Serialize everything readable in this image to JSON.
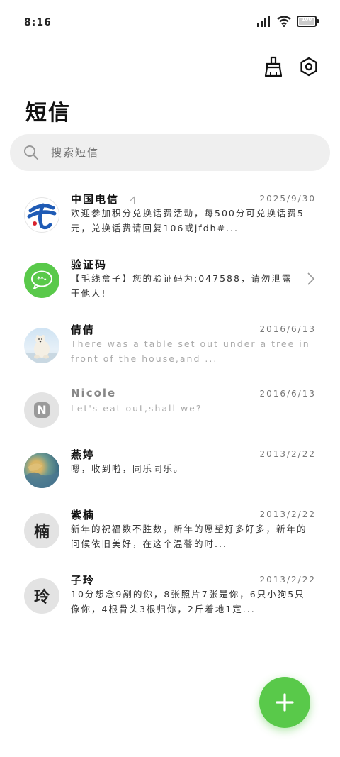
{
  "status_bar": {
    "time": "8:16",
    "battery_level": "100"
  },
  "header": {
    "title": "短信"
  },
  "search": {
    "placeholder": "搜索短信"
  },
  "threads": [
    {
      "name": "中国电信",
      "date": "2025/9/30",
      "preview": "欢迎参加积分兑换话费活动，每500分可兑换话费5元，兑换话费请回复106或jfdh#...",
      "avatar": "china-telecom-logo"
    },
    {
      "name": "验证码",
      "date": "",
      "preview": "【毛线盒子】您的验证码为:047588，请勿泄露于他人!",
      "avatar": "chat-bubble-icon"
    },
    {
      "name": "倩倩",
      "date": "2016/6/13",
      "preview": "There was a table set out under a tree in front of the house,and ...",
      "avatar": "polar-bear-photo"
    },
    {
      "name": "Nicole",
      "date": "2016/6/13",
      "preview": "Let's eat out,shall we?",
      "avatar_letter": "N"
    },
    {
      "name": "燕婷",
      "date": "2013/2/22",
      "preview": "嗯，收到啦，同乐同乐。",
      "avatar": "landscape-photo"
    },
    {
      "name": "紫楠",
      "date": "2013/2/22",
      "preview": "新年的祝福数不胜数，新年的愿望好多好多，新年的问候依旧美好，在这个温馨的时...",
      "avatar_letter": "楠"
    },
    {
      "name": "子玲",
      "date": "2013/2/22",
      "preview": "10分想念9剐的你，8张照片7张是你，6只小狗5只像你，4根骨头3根归你，2斤着地1定...",
      "avatar_letter": "玲"
    }
  ],
  "colors": {
    "accent": "#59c94a",
    "telecom_blue": "#1f5bb5",
    "search_bg": "#efefef"
  },
  "icons": [
    "cellular-icon",
    "wifi-icon",
    "battery-icon",
    "broom-icon",
    "settings-icon",
    "search-icon",
    "chevron-right-icon",
    "plus-icon"
  ]
}
